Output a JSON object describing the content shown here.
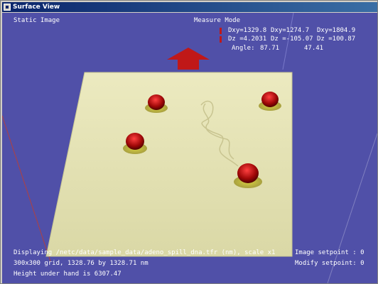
{
  "window": {
    "title": "Surface View"
  },
  "hud": {
    "mode_left": "Static Image",
    "mode_right": "Measure Mode",
    "dxy_1": "Dxy=1329.8",
    "dxy_2": "Dxy=1274.7",
    "dxy_3": "Dxy=1804.9",
    "dz_1": "Dz =4.2031",
    "dz_2": "Dz =-105.07",
    "dz_3": "Dz =100.87",
    "angle_label": "Angle:",
    "angle_1": "87.71",
    "angle_2": "47.41",
    "footer_line1": "Displaying /netc/data/sample_data/adeno_spill_dna.tfr (nm), scale x1",
    "footer_line2": "300x300 grid, 1328.76 by 1328.71 nm",
    "footer_line3": "Height under hand is 6307.47",
    "image_setpoint": "Image setpoint : 0",
    "modify_setpoint": "Modify setpoint: 0"
  },
  "colors": {
    "background": "#5050a8",
    "surface": "#e8e6b8",
    "arrow": "#c01818",
    "titlebar": "#0a246a"
  },
  "icons": {
    "app": "window-app-icon",
    "arrow": "up-arrow-icon"
  }
}
